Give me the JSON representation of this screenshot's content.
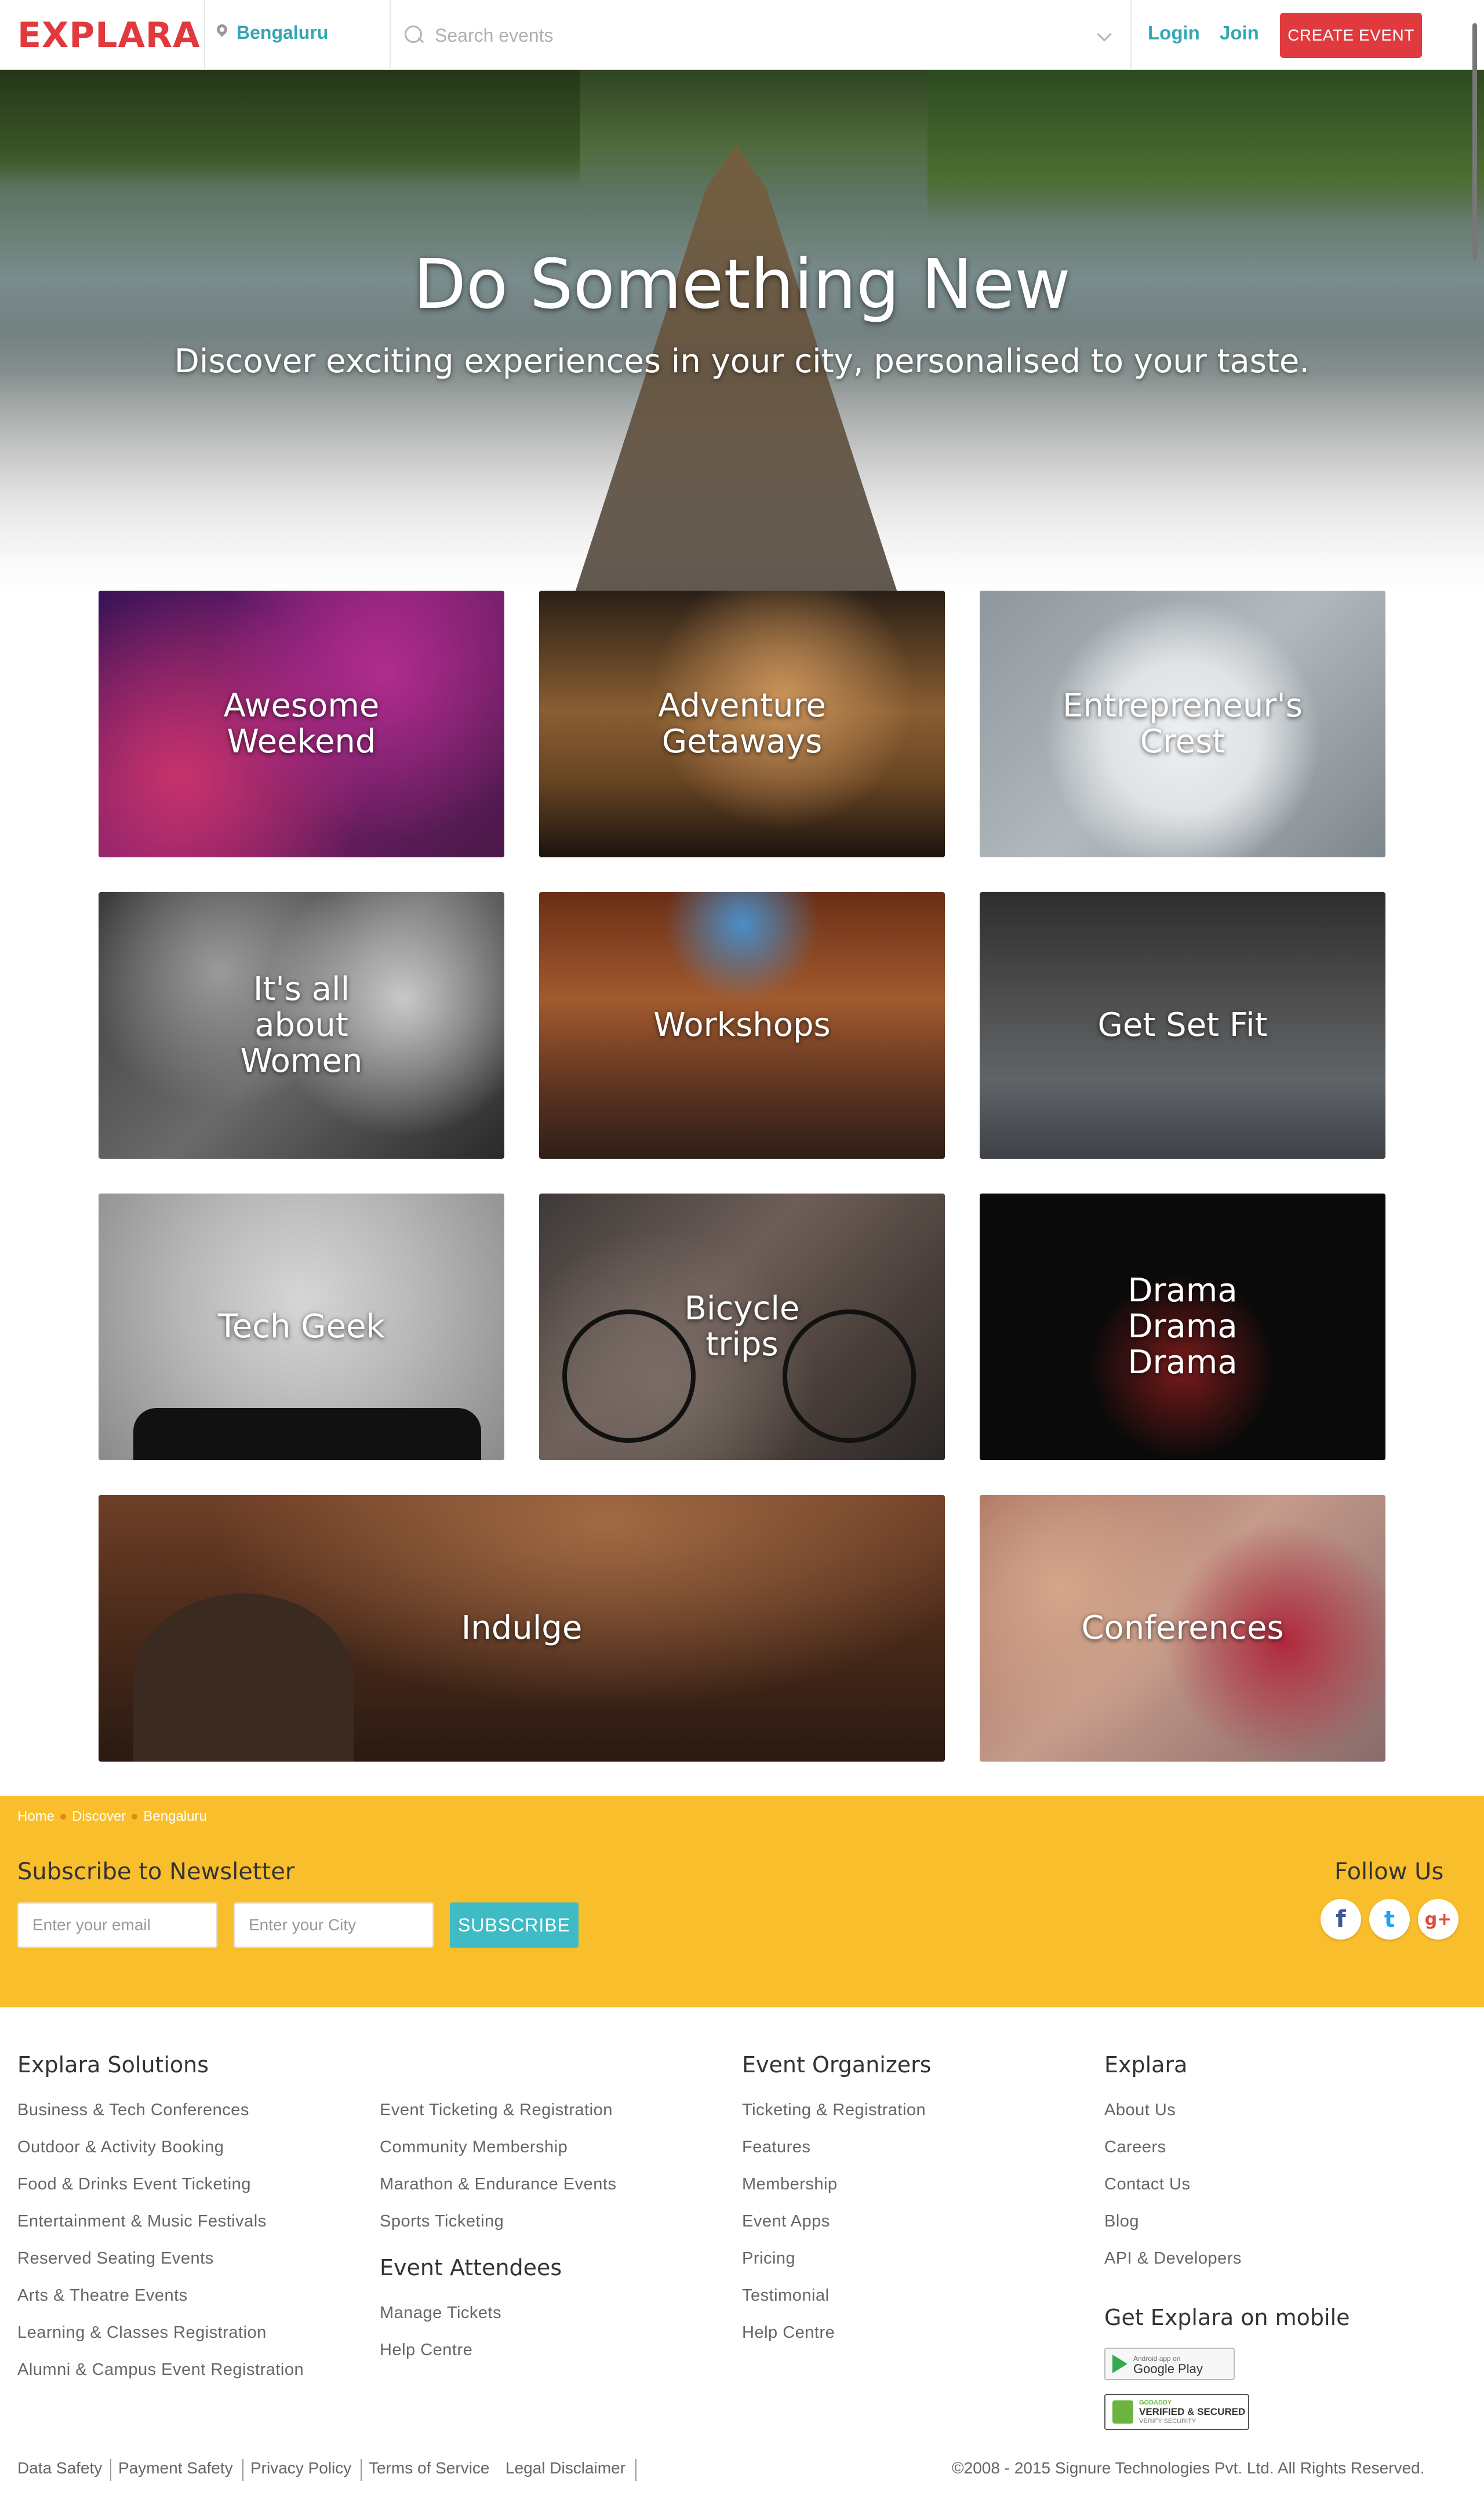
{
  "header": {
    "logo": "EXPLARA",
    "location": "Bengaluru",
    "search_placeholder": "Search events",
    "login": "Login",
    "join": "Join",
    "create_event": "CREATE EVENT",
    "colors": {
      "brand_red": "#e03a3e",
      "accent_teal": "#32a7b5"
    }
  },
  "hero": {
    "title": "Do Something New",
    "subtitle": "Discover exciting experiences in your city, personalised to your taste."
  },
  "tiles": [
    {
      "label": "Awesome\nWeekend"
    },
    {
      "label": "Adventure\nGetaways"
    },
    {
      "label": "Entrepreneur's\nCrest"
    },
    {
      "label": "It's all\nabout\nWomen"
    },
    {
      "label": "Workshops"
    },
    {
      "label": "Get Set Fit"
    },
    {
      "label": "Tech Geek"
    },
    {
      "label": "Bicycle\ntrips"
    },
    {
      "label": "Drama\nDrama\nDrama"
    },
    {
      "label": "Indulge"
    },
    {
      "label": "Conferences"
    }
  ],
  "newsletter": {
    "breadcrumb": [
      "Home",
      "Discover",
      "Bengaluru"
    ],
    "title": "Subscribe to Newsletter",
    "email_placeholder": "Enter your email",
    "city_placeholder": "Enter your City",
    "subscribe": "SUBSCRIBE",
    "follow_us": "Follow Us",
    "social": [
      "f",
      "t",
      "g+"
    ],
    "band_color": "#f9be2c"
  },
  "footer": {
    "solutions_title": "Explara Solutions",
    "solutions_col1": [
      "Business & Tech Conferences",
      "Outdoor & Activity Booking",
      "Food & Drinks Event Ticketing",
      "Entertainment & Music Festivals",
      "Reserved Seating Events",
      "Arts & Theatre Events",
      "Learning & Classes Registration",
      "Alumni & Campus Event Registration"
    ],
    "solutions_col2": [
      "Event Ticketing & Registration",
      "Community Membership",
      "Marathon & Endurance Events",
      "Sports Ticketing"
    ],
    "attendees_title": "Event Attendees",
    "attendees": [
      "Manage Tickets",
      "Help Centre"
    ],
    "organizers_title": "Event Organizers",
    "organizers": [
      "Ticketing & Registration",
      "Features",
      "Membership",
      "Event Apps",
      "Pricing",
      "Testimonial",
      "Help Centre"
    ],
    "explara_title": "Explara",
    "explara": [
      "About Us",
      "Careers",
      "Contact Us",
      "Blog",
      "API & Developers"
    ],
    "mobile_title": "Get Explara on mobile",
    "google_play_small": "Android app on",
    "google_play": "Google Play",
    "godaddy_small": "GODADDY",
    "godaddy": "VERIFIED & SECURED",
    "godaddy_sub": "VERIFY SECURITY",
    "bottom_links": [
      "Data Safety",
      "Payment Safety",
      "Privacy Policy",
      "Terms of Service",
      "Legal Disclaimer"
    ],
    "copyright": "©2008 - 2015 Signure Technologies Pvt. Ltd. All Rights Reserved."
  }
}
